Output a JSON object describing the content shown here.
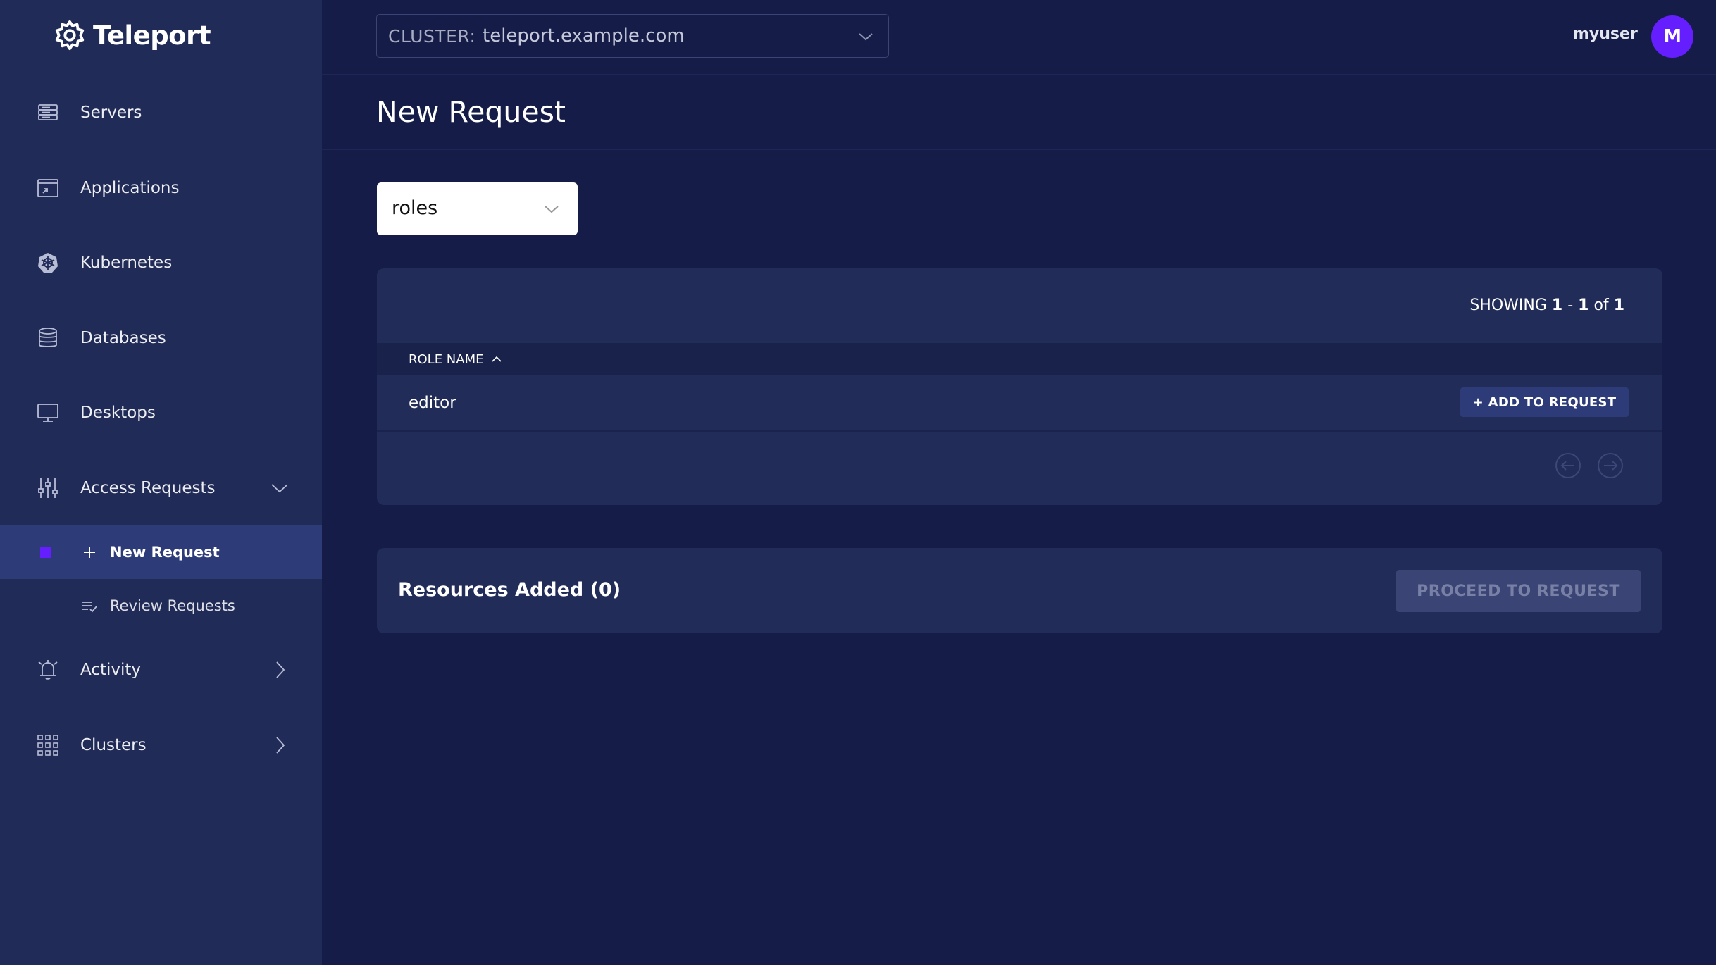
{
  "app": {
    "brand": "Teleport"
  },
  "sidebar": {
    "items": [
      {
        "label": "Servers",
        "icon": "server-icon"
      },
      {
        "label": "Applications",
        "icon": "application-icon"
      },
      {
        "label": "Kubernetes",
        "icon": "kubernetes-icon"
      },
      {
        "label": "Databases",
        "icon": "database-icon"
      },
      {
        "label": "Desktops",
        "icon": "desktop-icon"
      },
      {
        "label": "Access Requests",
        "icon": "sliders-icon",
        "expanded": true
      },
      {
        "label": "Activity",
        "icon": "bell-icon"
      },
      {
        "label": "Clusters",
        "icon": "grid-icon"
      }
    ],
    "subitems": [
      {
        "label": "New Request",
        "icon": "plus-icon",
        "active": true
      },
      {
        "label": "Review Requests",
        "icon": "list-check-icon",
        "active": false
      }
    ]
  },
  "topbar": {
    "cluster_label": "CLUSTER:",
    "cluster_value": "teleport.example.com",
    "username": "myuser",
    "avatar_initial": "M"
  },
  "page": {
    "title": "New Request"
  },
  "resource_kind": {
    "selected": "roles"
  },
  "table": {
    "showing_prefix": "SHOWING",
    "showing_from": "1",
    "showing_to": "1",
    "showing_of": "of",
    "showing_total": "1",
    "column_header": "ROLE NAME",
    "rows": [
      {
        "name": "editor",
        "action": "+ ADD TO REQUEST"
      }
    ]
  },
  "summary": {
    "title": "Resources Added (0)",
    "proceed_label": "PROCEED TO REQUEST"
  },
  "colors": {
    "background": "#141c47",
    "sidebar": "#212b58",
    "accent": "#651fff",
    "active_item": "#2e3b79"
  }
}
